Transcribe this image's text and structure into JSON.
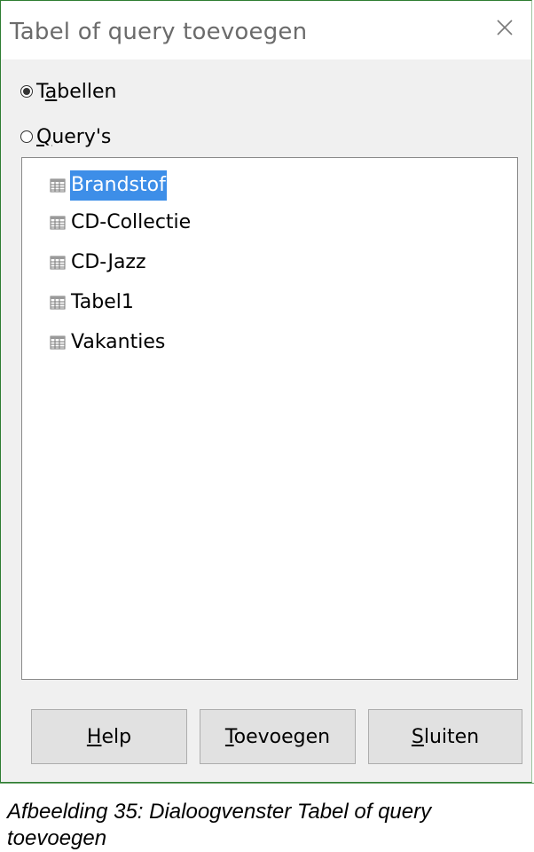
{
  "dialog": {
    "title": "Tabel of query toevoegen",
    "close_icon": "close-icon"
  },
  "source_type": {
    "options": [
      {
        "pre": "T",
        "accel": "a",
        "post": "bellen",
        "checked": true
      },
      {
        "pre": "",
        "accel": "Q",
        "post": "uery's",
        "checked": false
      }
    ]
  },
  "list": {
    "icon": "table-icon",
    "items": [
      {
        "label": "Brandstof",
        "selected": true
      },
      {
        "label": "CD-Collectie",
        "selected": false
      },
      {
        "label": "CD-Jazz",
        "selected": false
      },
      {
        "label": "Tabel1",
        "selected": false
      },
      {
        "label": "Vakanties",
        "selected": false
      }
    ]
  },
  "buttons": {
    "help": {
      "accel": "H",
      "rest": "elp"
    },
    "add": {
      "accel": "T",
      "rest": "oevoegen"
    },
    "close": {
      "accel": "S",
      "rest": "luiten"
    }
  },
  "colors": {
    "selection": "#3d8ee8",
    "frame": "#2e7d32"
  },
  "caption": "Afbeelding 35: Dialoogvenster Tabel of query toevoegen"
}
